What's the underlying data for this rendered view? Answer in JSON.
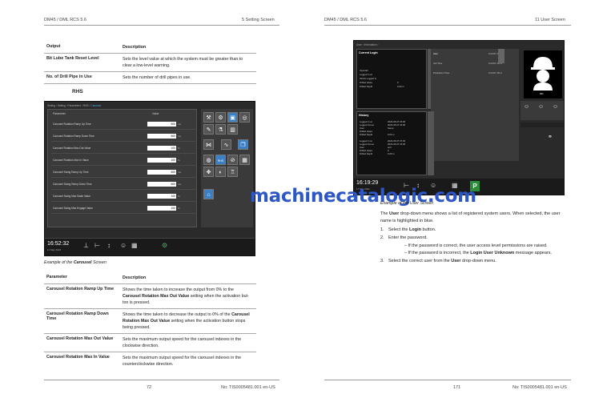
{
  "header": {
    "left_doc": "DM45 / DML RCS 5.6",
    "left_section": "5 Setting Screen",
    "right_doc": "DM45 / DML RCS 5.6",
    "right_section": "11 User Screen"
  },
  "top_table": {
    "col_output": "Output",
    "col_description": "Description",
    "rows": [
      {
        "name": "Bit Lube Tank Reset Level",
        "desc1": "Sets the level value at which the system must be greater than to",
        "desc2": "clear a low-level warning."
      },
      {
        "name": "No. of Drill Pipe in Use",
        "desc1": "Sets the number of drill pipes in use.",
        "desc2": ""
      }
    ]
  },
  "rhs_heading": "RHS",
  "carousel_shot": {
    "crumb_prefix": "Setting › Setting › Parameters › RHS ›",
    "crumb_active": "Carousel",
    "col_parameter": "Parameter",
    "col_value": "Value",
    "rows": [
      {
        "label": "Carousel Rotation Ramp Up Time",
        "value": "500",
        "unit": "ms"
      },
      {
        "label": "Carousel Rotation Ramp Down Time",
        "value": "500",
        "unit": "ms"
      },
      {
        "label": "Carousel Rotation Max Out Value",
        "value": "100",
        "unit": "%"
      },
      {
        "label": "Carousel Rotation Max In Value",
        "value": "100",
        "unit": "%"
      },
      {
        "label": "Carousel Swing Ramp Up Time",
        "value": "500",
        "unit": "ms"
      },
      {
        "label": "Carousel Swing Ramp Down Time",
        "value": "500",
        "unit": "ms"
      },
      {
        "label": "Carousel Swing Max Swab Value",
        "value": "100",
        "unit": "%"
      },
      {
        "label": "Carousel Swing Max Engage Value",
        "value": "100",
        "unit": "%"
      }
    ],
    "clock": "16:52:32",
    "date": "11 May 2023",
    "rhs_label": "RHS"
  },
  "carousel_caption": {
    "prefix": "Example of the",
    "bold": "Carousel",
    "suffix": "Screen"
  },
  "param_table": {
    "col_parameter": "Parameter",
    "col_description": "Description",
    "rows": [
      {
        "name1": "Carousel Rotation Ramp Up Time",
        "name2": "",
        "d1": "Shows the time taken to increase the output from 0% to the",
        "d2b": "Carousel Rotation Max Out Value",
        "d2": " setting when the activation but-",
        "d3": "ton is pressed."
      },
      {
        "name1": "Carousel Rotation Ramp Down",
        "name2": "Time",
        "d1": "Shows the time taken to decrease the output to 0% of the",
        "d2b": "Carousel",
        "d2": "",
        "d2bb": "Rotation Max Out Value",
        "d2c": " setting when the activation button stops",
        "d3": "being pressed."
      },
      {
        "name1": "Carousel Rotation Max Out Value",
        "name2": "",
        "d1": "Sets the maximum output speed for the carousel indexes in the",
        "d3": "clockwise direction."
      },
      {
        "name1": "Carousel Rotation Max In Value",
        "name2": "",
        "d1": "Sets the maximum output speed for the carousel indexes in the",
        "d3": "counterclockwise direction."
      }
    ]
  },
  "user_shot": {
    "crumb": "User › Information ›",
    "current_login": "Current Login",
    "col_user": "User",
    "user_value": "0 d 00 h 00 m",
    "job_time": "Job Time",
    "job_time_value": "0 d 00 h 00 m",
    "production_time": "Production Time",
    "production_time_value": "0 d 00 h 00 m",
    "login_lines": [
      "Operator",
      "Logged In at",
      "Works Logged In",
      "Drilled Holes",
      "Drilled Depth"
    ],
    "login_values": [
      "",
      "",
      "",
      "0",
      "0.00 m"
    ],
    "history": "History",
    "history_lines": [
      "Logged In at",
      "Logged Out at",
      "User",
      "Drilled Holes",
      "Drilled Depth"
    ],
    "history_values": [
      "2023-05-07 15:30",
      "2023-05-07 16:00",
      "Sarup",
      "",
      "0.00 m"
    ],
    "history2_values": [
      "2023-05-07 07:30",
      "2023-05-07 15:30",
      "unit",
      "0",
      "0.00 m"
    ],
    "avatar_label": "001",
    "clock": "16:19:29",
    "date": "17 Mar 2021",
    "p_button": "P"
  },
  "watermark": "machinecatalogic.com",
  "right_caption": "Example of the User Screen",
  "right_para": {
    "p1a": "The",
    "p1b": "User",
    "p1c": "drop-down menu shows a list of registered system users. When selected, the user",
    "p1d": "name is highlighted in blue."
  },
  "steps": {
    "s1": {
      "num": "1.",
      "a": "Select the",
      "b": "Login",
      "c": "button."
    },
    "s2": {
      "num": "2.",
      "a": "Enter the password."
    },
    "sub1": {
      "dash": "–",
      "a": "If the password is correct, the user access level permissions are raised."
    },
    "sub2": {
      "dash": "–",
      "a": "If the password is incorrect, the",
      "b": "Login User Unknown",
      "c": "message appears."
    },
    "s3": {
      "num": "3.",
      "a": "Select the correct user from the",
      "b": "User",
      "c": "drop-down menu."
    }
  },
  "footer": {
    "left_page": "72",
    "left_doc": "No: TIS0005481.001 en-US",
    "right_page": "171",
    "right_doc": "No: TIS0005481.001 en-US"
  }
}
